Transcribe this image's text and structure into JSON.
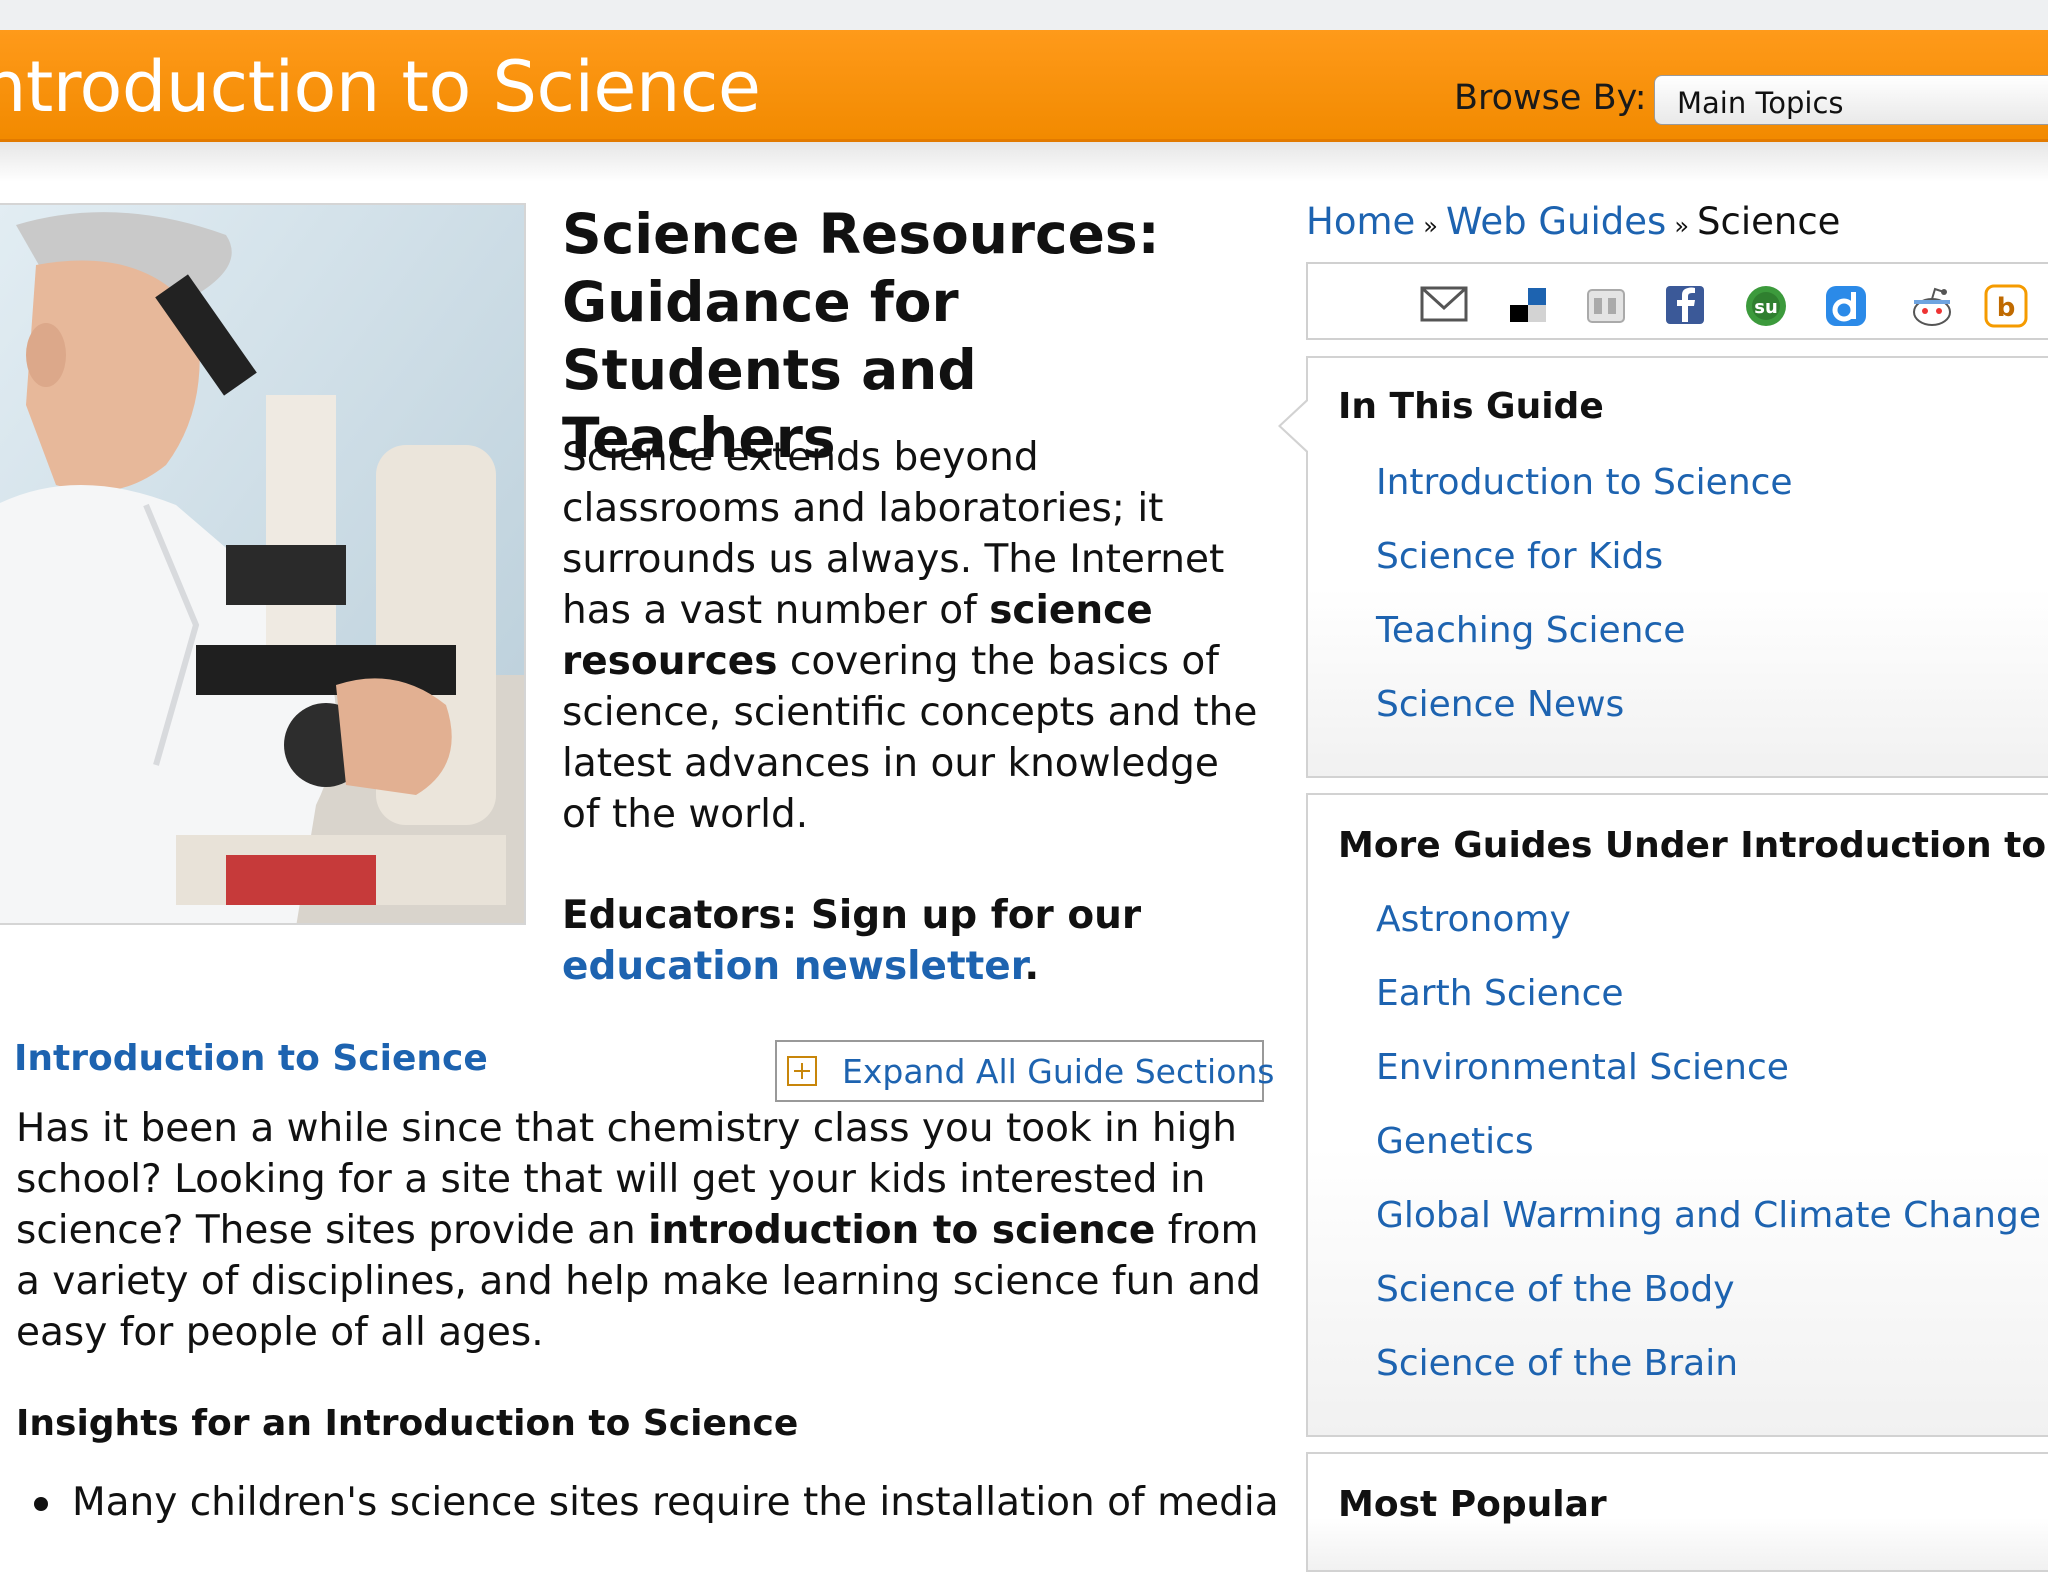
{
  "header": {
    "title": "ntroduction to Science",
    "browse_label": "Browse By:",
    "browse_selected": "Main Topics"
  },
  "article": {
    "title": "Science Resources: Guidance for Students and Teachers",
    "intro_before": "Science extends beyond classrooms and laboratories; it surrounds us always. The Internet has a vast number of ",
    "intro_bold": "science resources",
    "intro_after": " covering the basics of science, scientific concepts and the latest advances in our knowledge of the world.",
    "educators_text": "Educators: Sign up for our ",
    "newsletter_link": "education newsletter",
    "educators_end": "."
  },
  "section": {
    "title": "Introduction to Science",
    "expand_label": "Expand All Guide Sections",
    "body_before": "Has it been a while since that chemistry class you took in high school? Looking for a site that will get your kids interested in science? These sites provide an ",
    "body_bold": "introduction to science",
    "body_after": " from a variety of disciplines, and help make learning science fun and easy for people of all ages.",
    "insights_title": "Insights for an Introduction to Science",
    "bullet_1": "Many children's science sites require the installation of media"
  },
  "breadcrumb": {
    "home": "Home",
    "sep": "»",
    "guides": "Web Guides",
    "current": "Science"
  },
  "share_icons": [
    "email-icon",
    "delicious-icon",
    "digg-icon",
    "facebook-icon",
    "stumbleupon-icon",
    "diigo-icon",
    "reddit-icon",
    "blinklist-icon"
  ],
  "in_this_guide": {
    "heading": "In This Guide",
    "items": [
      "Introduction to Science",
      "Science for Kids",
      "Teaching Science",
      "Science News"
    ]
  },
  "more_guides": {
    "heading": "More Guides Under Introduction to Scier",
    "items": [
      "Astronomy",
      "Earth Science",
      "Environmental Science",
      "Genetics",
      "Global Warming and Climate Change",
      "Science of the Body",
      "Science of the Brain"
    ]
  },
  "most_popular": {
    "heading": "Most Popular"
  },
  "colors": {
    "header_orange": "#f28a00",
    "link_blue": "#1d63b0"
  }
}
